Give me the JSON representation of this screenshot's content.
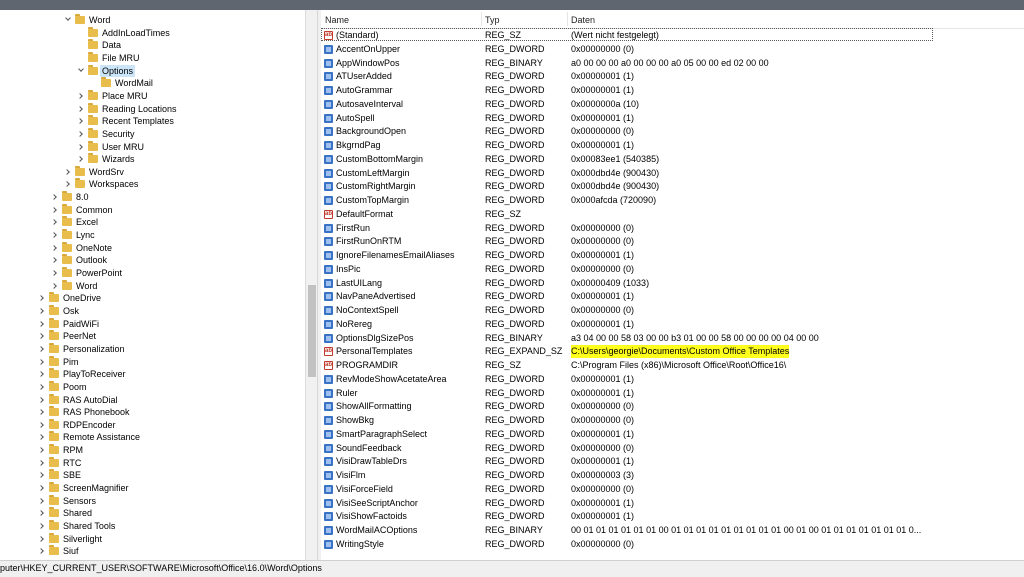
{
  "tree": {
    "nodes": [
      {
        "label": "Word",
        "state": "expanded",
        "depth": 3
      },
      {
        "label": "AddInLoadTimes",
        "state": "none",
        "depth": 4
      },
      {
        "label": "Data",
        "state": "none",
        "depth": 4
      },
      {
        "label": "File MRU",
        "state": "none",
        "depth": 4
      },
      {
        "label": "Options",
        "state": "expanded",
        "depth": 4,
        "selected": true
      },
      {
        "label": "WordMail",
        "state": "none",
        "depth": 5
      },
      {
        "label": "Place MRU",
        "state": "collapsed",
        "depth": 4
      },
      {
        "label": "Reading Locations",
        "state": "collapsed",
        "depth": 4
      },
      {
        "label": "Recent Templates",
        "state": "collapsed",
        "depth": 4
      },
      {
        "label": "Security",
        "state": "collapsed",
        "depth": 4
      },
      {
        "label": "User MRU",
        "state": "collapsed",
        "depth": 4
      },
      {
        "label": "Wizards",
        "state": "collapsed",
        "depth": 4
      },
      {
        "label": "WordSrv",
        "state": "collapsed",
        "depth": 3
      },
      {
        "label": "Workspaces",
        "state": "collapsed",
        "depth": 3
      },
      {
        "label": "8.0",
        "state": "collapsed",
        "depth": 2
      },
      {
        "label": "Common",
        "state": "collapsed",
        "depth": 2
      },
      {
        "label": "Excel",
        "state": "collapsed",
        "depth": 2
      },
      {
        "label": "Lync",
        "state": "collapsed",
        "depth": 2
      },
      {
        "label": "OneNote",
        "state": "collapsed",
        "depth": 2
      },
      {
        "label": "Outlook",
        "state": "collapsed",
        "depth": 2
      },
      {
        "label": "PowerPoint",
        "state": "collapsed",
        "depth": 2
      },
      {
        "label": "Word",
        "state": "collapsed",
        "depth": 2
      },
      {
        "label": "OneDrive",
        "state": "collapsed",
        "depth": 1
      },
      {
        "label": "Osk",
        "state": "collapsed",
        "depth": 1
      },
      {
        "label": "PaidWiFi",
        "state": "collapsed",
        "depth": 1
      },
      {
        "label": "PeerNet",
        "state": "collapsed",
        "depth": 1
      },
      {
        "label": "Personalization",
        "state": "collapsed",
        "depth": 1
      },
      {
        "label": "Pim",
        "state": "collapsed",
        "depth": 1
      },
      {
        "label": "PlayToReceiver",
        "state": "collapsed",
        "depth": 1
      },
      {
        "label": "Poom",
        "state": "collapsed",
        "depth": 1
      },
      {
        "label": "RAS AutoDial",
        "state": "collapsed",
        "depth": 1
      },
      {
        "label": "RAS Phonebook",
        "state": "collapsed",
        "depth": 1
      },
      {
        "label": "RDPEncoder",
        "state": "collapsed",
        "depth": 1
      },
      {
        "label": "Remote Assistance",
        "state": "collapsed",
        "depth": 1
      },
      {
        "label": "RPM",
        "state": "collapsed",
        "depth": 1
      },
      {
        "label": "RTC",
        "state": "collapsed",
        "depth": 1
      },
      {
        "label": "SBE",
        "state": "collapsed",
        "depth": 1
      },
      {
        "label": "ScreenMagnifier",
        "state": "collapsed",
        "depth": 1
      },
      {
        "label": "Sensors",
        "state": "collapsed",
        "depth": 1
      },
      {
        "label": "Shared",
        "state": "collapsed",
        "depth": 1
      },
      {
        "label": "Shared Tools",
        "state": "collapsed",
        "depth": 1
      },
      {
        "label": "Silverlight",
        "state": "collapsed",
        "depth": 1
      },
      {
        "label": "Siuf",
        "state": "collapsed",
        "depth": 1
      }
    ]
  },
  "values_header": {
    "name": "Name",
    "type": "Typ",
    "data": "Daten"
  },
  "values": [
    {
      "name": "(Standard)",
      "type": "REG_SZ",
      "data": "(Wert nicht festgelegt)",
      "icon": "sz"
    },
    {
      "name": "AccentOnUpper",
      "type": "REG_DWORD",
      "data": "0x00000000 (0)",
      "icon": "bin"
    },
    {
      "name": "AppWindowPos",
      "type": "REG_BINARY",
      "data": "a0 00 00 00 a0 00 00 00 a0 05 00 00 ed 02 00 00",
      "icon": "bin"
    },
    {
      "name": "ATUserAdded",
      "type": "REG_DWORD",
      "data": "0x00000001 (1)",
      "icon": "bin"
    },
    {
      "name": "AutoGrammar",
      "type": "REG_DWORD",
      "data": "0x00000001 (1)",
      "icon": "bin"
    },
    {
      "name": "AutosaveInterval",
      "type": "REG_DWORD",
      "data": "0x0000000a (10)",
      "icon": "bin"
    },
    {
      "name": "AutoSpell",
      "type": "REG_DWORD",
      "data": "0x00000001 (1)",
      "icon": "bin"
    },
    {
      "name": "BackgroundOpen",
      "type": "REG_DWORD",
      "data": "0x00000000 (0)",
      "icon": "bin"
    },
    {
      "name": "BkgrndPag",
      "type": "REG_DWORD",
      "data": "0x00000001 (1)",
      "icon": "bin"
    },
    {
      "name": "CustomBottomMargin",
      "type": "REG_DWORD",
      "data": "0x00083ee1 (540385)",
      "icon": "bin"
    },
    {
      "name": "CustomLeftMargin",
      "type": "REG_DWORD",
      "data": "0x000dbd4e (900430)",
      "icon": "bin"
    },
    {
      "name": "CustomRightMargin",
      "type": "REG_DWORD",
      "data": "0x000dbd4e (900430)",
      "icon": "bin"
    },
    {
      "name": "CustomTopMargin",
      "type": "REG_DWORD",
      "data": "0x000afcda (720090)",
      "icon": "bin"
    },
    {
      "name": "DefaultFormat",
      "type": "REG_SZ",
      "data": "",
      "icon": "sz"
    },
    {
      "name": "FirstRun",
      "type": "REG_DWORD",
      "data": "0x00000000 (0)",
      "icon": "bin"
    },
    {
      "name": "FirstRunOnRTM",
      "type": "REG_DWORD",
      "data": "0x00000000 (0)",
      "icon": "bin"
    },
    {
      "name": "IgnoreFilenamesEmailAliases",
      "type": "REG_DWORD",
      "data": "0x00000001 (1)",
      "icon": "bin"
    },
    {
      "name": "InsPic",
      "type": "REG_DWORD",
      "data": "0x00000000 (0)",
      "icon": "bin"
    },
    {
      "name": "LastUILang",
      "type": "REG_DWORD",
      "data": "0x00000409 (1033)",
      "icon": "bin"
    },
    {
      "name": "NavPaneAdvertised",
      "type": "REG_DWORD",
      "data": "0x00000001 (1)",
      "icon": "bin"
    },
    {
      "name": "NoContextSpell",
      "type": "REG_DWORD",
      "data": "0x00000000 (0)",
      "icon": "bin"
    },
    {
      "name": "NoRereg",
      "type": "REG_DWORD",
      "data": "0x00000001 (1)",
      "icon": "bin"
    },
    {
      "name": "OptionsDlgSizePos",
      "type": "REG_BINARY",
      "data": "a3 04 00 00 58 03 00 00 b3 01 00 00 58 00 00 00 00 04 00 00",
      "icon": "bin"
    },
    {
      "name": "PersonalTemplates",
      "type": "REG_EXPAND_SZ",
      "data": "C:\\Users\\georgie\\Documents\\Custom Office Templates",
      "icon": "sz",
      "highlight": true
    },
    {
      "name": "PROGRAMDIR",
      "type": "REG_SZ",
      "data": "C:\\Program Files (x86)\\Microsoft Office\\Root\\Office16\\",
      "icon": "sz"
    },
    {
      "name": "RevModeShowAcetateArea",
      "type": "REG_DWORD",
      "data": "0x00000001 (1)",
      "icon": "bin"
    },
    {
      "name": "Ruler",
      "type": "REG_DWORD",
      "data": "0x00000001 (1)",
      "icon": "bin"
    },
    {
      "name": "ShowAllFormatting",
      "type": "REG_DWORD",
      "data": "0x00000000 (0)",
      "icon": "bin"
    },
    {
      "name": "ShowBkg",
      "type": "REG_DWORD",
      "data": "0x00000000 (0)",
      "icon": "bin"
    },
    {
      "name": "SmartParagraphSelect",
      "type": "REG_DWORD",
      "data": "0x00000001 (1)",
      "icon": "bin"
    },
    {
      "name": "SoundFeedback",
      "type": "REG_DWORD",
      "data": "0x00000000 (0)",
      "icon": "bin"
    },
    {
      "name": "VisiDrawTableDrs",
      "type": "REG_DWORD",
      "data": "0x00000001 (1)",
      "icon": "bin"
    },
    {
      "name": "VisiFlm",
      "type": "REG_DWORD",
      "data": "0x00000003 (3)",
      "icon": "bin"
    },
    {
      "name": "VisiForceField",
      "type": "REG_DWORD",
      "data": "0x00000000 (0)",
      "icon": "bin"
    },
    {
      "name": "VisiSeeScriptAnchor",
      "type": "REG_DWORD",
      "data": "0x00000001 (1)",
      "icon": "bin"
    },
    {
      "name": "VisiShowFactoids",
      "type": "REG_DWORD",
      "data": "0x00000001 (1)",
      "icon": "bin"
    },
    {
      "name": "WordMailACOptions",
      "type": "REG_BINARY",
      "data": "00 01 01 01 01 01 01 00 01 01 01 01 01 01 01 01 01 00 01 00 01 01 01 01 01 01 01 0...",
      "icon": "bin"
    },
    {
      "name": "WritingStyle",
      "type": "REG_DWORD",
      "data": "0x00000000 (0)",
      "icon": "bin"
    }
  ],
  "status": {
    "path": "puter\\HKEY_CURRENT_USER\\SOFTWARE\\Microsoft\\Office\\16.0\\Word\\Options"
  },
  "colors": {
    "highlight": "#ffff1e",
    "folder": "#e9bd4c",
    "selection": "#cce4f7"
  }
}
